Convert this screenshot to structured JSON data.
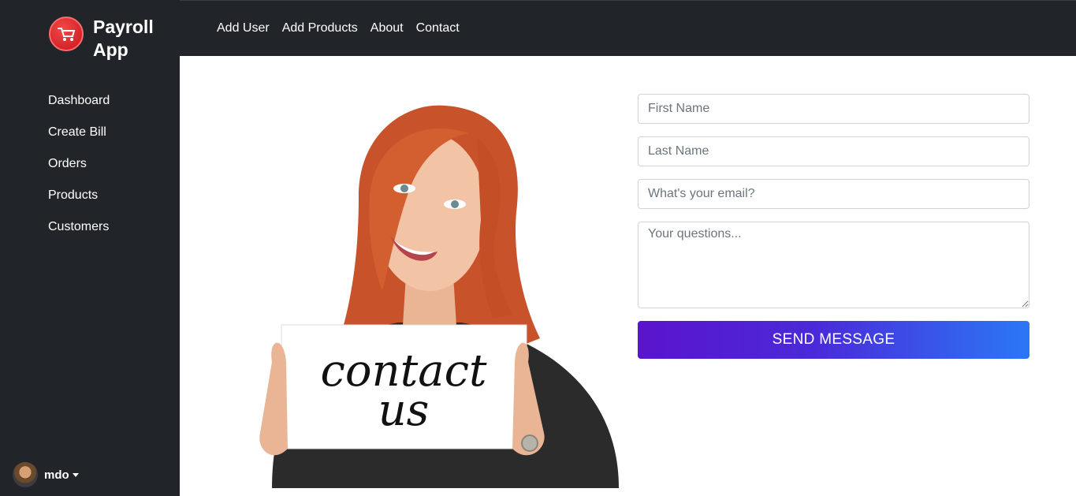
{
  "brand": {
    "name": "Payroll App",
    "logo_icon": "cart-icon",
    "logo_color": "#d91c22"
  },
  "sidebar": {
    "items": [
      {
        "label": "Dashboard"
      },
      {
        "label": "Create Bill"
      },
      {
        "label": "Orders"
      },
      {
        "label": "Products"
      },
      {
        "label": "Customers"
      }
    ],
    "user": {
      "name": "mdo"
    }
  },
  "topnav": {
    "links": [
      {
        "label": "Add User"
      },
      {
        "label": "Add Products"
      },
      {
        "label": "About"
      },
      {
        "label": "Contact"
      }
    ]
  },
  "contact": {
    "image": {
      "sign_line1": "contact",
      "sign_line2": "us"
    },
    "fields": {
      "first_name": {
        "placeholder": "First Name",
        "value": ""
      },
      "last_name": {
        "placeholder": "Last Name",
        "value": ""
      },
      "email": {
        "placeholder": "What's your email?",
        "value": ""
      },
      "questions": {
        "placeholder": "Your questions...",
        "value": ""
      }
    },
    "send_label": "SEND MESSAGE"
  },
  "colors": {
    "sidebar_bg": "#212529",
    "button_gradient_start": "#5a14cc",
    "button_gradient_end": "#2a78f6"
  }
}
